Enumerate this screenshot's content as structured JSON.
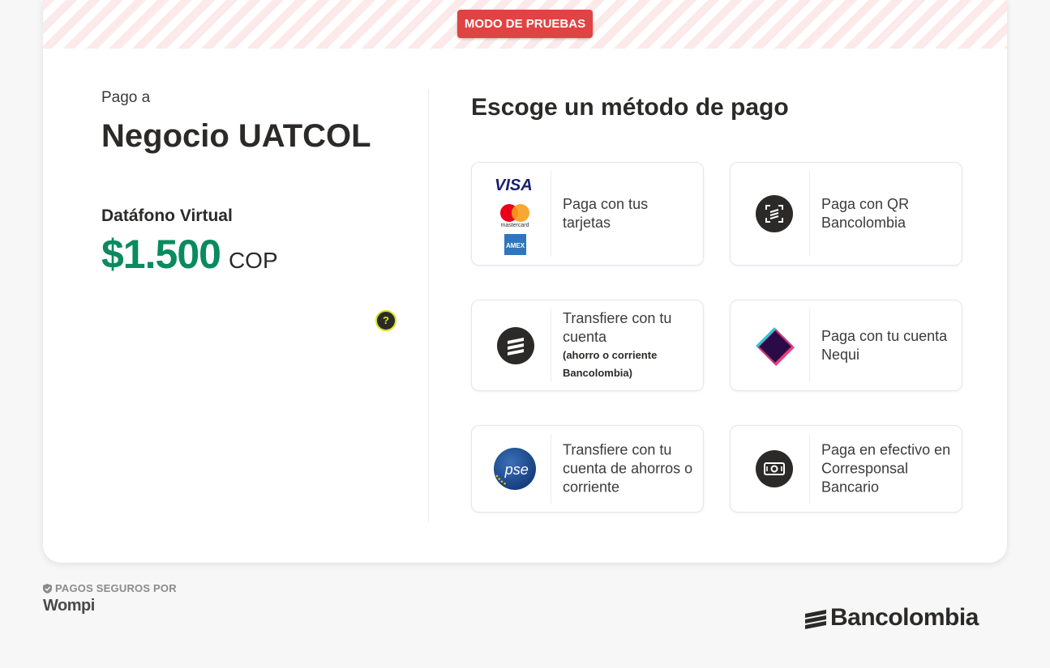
{
  "banner": {
    "test_mode": "MODO DE PRUEBAS"
  },
  "summary": {
    "pay_to": "Pago a",
    "merchant": "Negocio UATCOL",
    "terminal": "Datáfono Virtual",
    "amount": "$1.500",
    "currency": "COP",
    "help": "?"
  },
  "methods_title": "Escoge un método de pago",
  "methods": [
    {
      "label": "Paga con tus tarjetas",
      "icon": "card-brands-icon"
    },
    {
      "label": "Paga con QR Bancolombia",
      "icon": "qr-icon"
    },
    {
      "label": "Transfiere con tu cuenta",
      "sub": "(ahorro o corriente Bancolombia)",
      "icon": "bancolombia-icon"
    },
    {
      "label": "Paga con tu cuenta Nequi",
      "icon": "nequi-icon"
    },
    {
      "label": "Transfiere con tu cuenta de ahorros o corriente",
      "icon": "pse-icon"
    },
    {
      "label": "Paga en efectivo en Corresponsal Bancario",
      "icon": "cash-icon"
    }
  ],
  "card_brands": {
    "visa": "VISA",
    "mastercard": "mastercard",
    "amex": "AMEX"
  },
  "pse_text": "pse",
  "footer": {
    "secure": "PAGOS SEGUROS POR",
    "wompi": "Wompi",
    "bancolombia": "Bancolombia"
  },
  "colors": {
    "accent_green": "#0a8a5f",
    "test_red": "#e04343",
    "dark": "#2c2a29"
  }
}
